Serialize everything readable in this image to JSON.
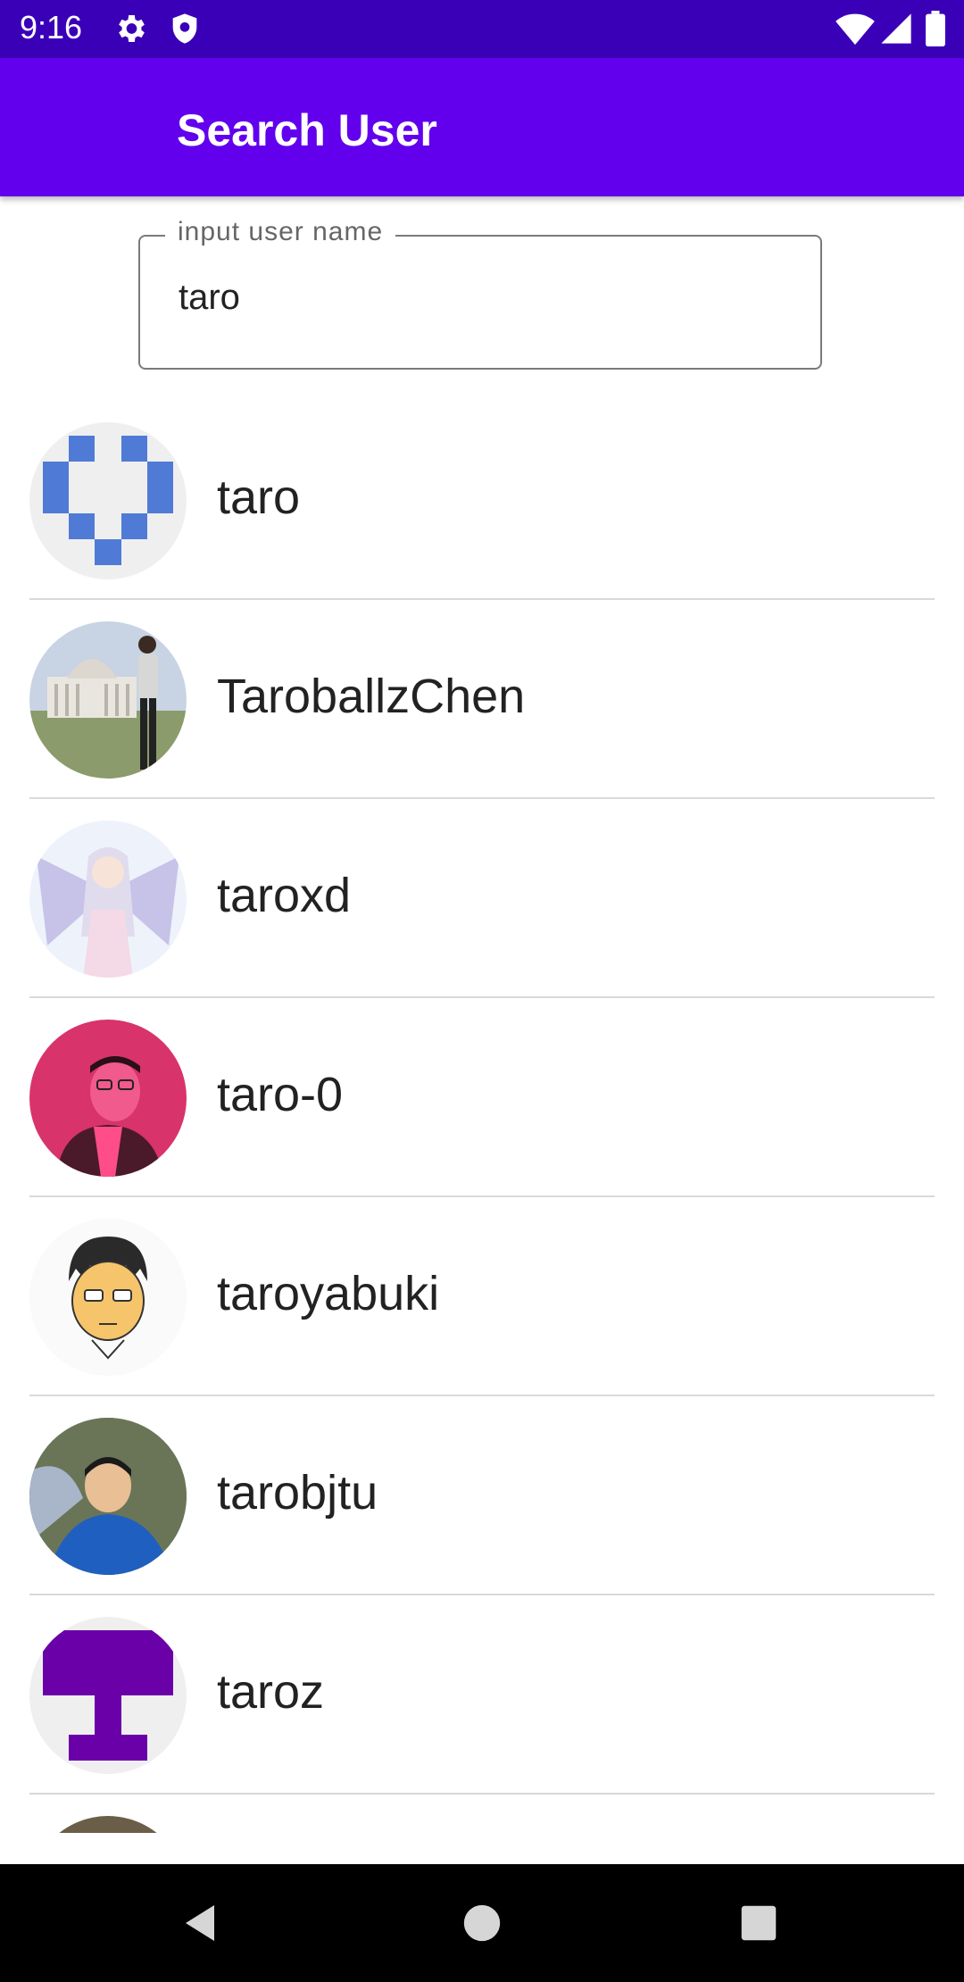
{
  "status_bar": {
    "time": "9:16"
  },
  "app_bar": {
    "title": "Search User"
  },
  "search": {
    "label": "input user name",
    "value": "taro"
  },
  "users": [
    {
      "name": "taro",
      "avatar": "identicon-avatar"
    },
    {
      "name": "TaroballzChen",
      "avatar": "photo-avatar"
    },
    {
      "name": "taroxd",
      "avatar": "anime-avatar"
    },
    {
      "name": "taro-0",
      "avatar": "photo-avatar"
    },
    {
      "name": "taroyabuki",
      "avatar": "cartoon-avatar"
    },
    {
      "name": "tarobjtu",
      "avatar": "photo-avatar"
    },
    {
      "name": "taroz",
      "avatar": "identicon-avatar"
    },
    {
      "name": "",
      "avatar": "photo-avatar"
    }
  ],
  "colors": {
    "primary": "#6200ee",
    "status_bar": "#3a00b8"
  }
}
